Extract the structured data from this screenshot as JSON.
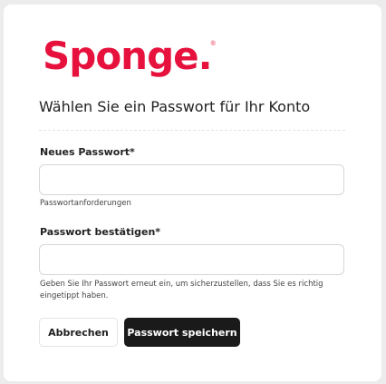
{
  "brand": {
    "name": "Sponge",
    "dot": ".",
    "registered": "®",
    "color": "#e6123d"
  },
  "title": "Wählen Sie ein Passwort für Ihr Konto",
  "new_password": {
    "label": "Neues Passwort*",
    "value": "",
    "hint": "Passwortanforderungen"
  },
  "confirm_password": {
    "label": "Passwort bestätigen*",
    "value": "",
    "hint": "Geben Sie Ihr Passwort erneut ein, um sicherzustellen, dass Sie es richtig eingetippt haben."
  },
  "actions": {
    "cancel_label": "Abbrechen",
    "save_label": "Passwort speichern"
  }
}
